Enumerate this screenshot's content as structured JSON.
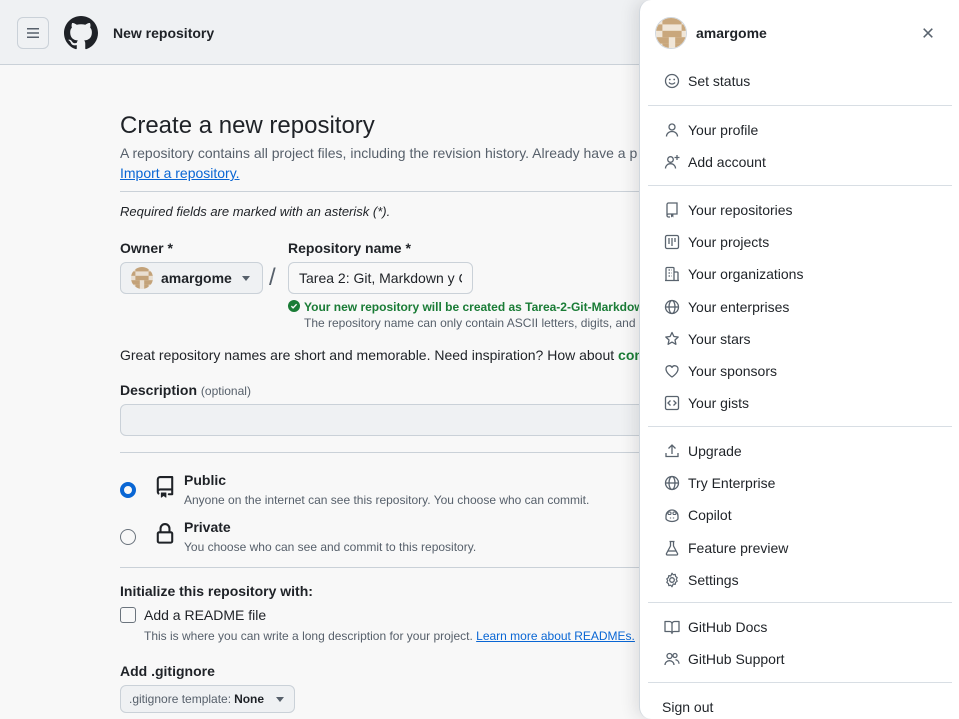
{
  "header": {
    "title": "New repository"
  },
  "form": {
    "title": "Create a new repository",
    "description": "A repository contains all project files, including the revision history. Already have a p",
    "import_link": "Import a repository.",
    "required_note": "Required fields are marked with an asterisk (*).",
    "owner_label": "Owner *",
    "owner_value": "amargome",
    "slash": "/",
    "repo_label": "Repository name *",
    "repo_value": "Tarea 2: Git, Markdown y C",
    "valid_message": "Your new repository will be created as Tarea-2-Git-Markdown-",
    "ascii_note": "The repository name can only contain ASCII letters, digits, and t",
    "inspiration_text": "Great repository names are short and memorable. Need inspiration? How about ",
    "inspiration_word": "con",
    "description_label": "Description",
    "description_optional": "(optional)",
    "description_value": "",
    "visibility": [
      {
        "title": "Public",
        "desc": "Anyone on the internet can see this repository. You choose who can commit.",
        "checked": true
      },
      {
        "title": "Private",
        "desc": "You choose who can see and commit to this repository.",
        "checked": false
      }
    ],
    "init_label": "Initialize this repository with:",
    "readme_label": "Add a README file",
    "readme_desc": "This is where you can write a long description for your project. ",
    "readme_link": "Learn more about READMEs.",
    "gitignore_label": "Add .gitignore",
    "gitignore_prefix": ".gitignore template:",
    "gitignore_value": "None"
  },
  "user_menu": {
    "username": "amargome",
    "groups": [
      [
        {
          "label": "Set status",
          "icon": "smiley-icon"
        }
      ],
      [
        {
          "label": "Your profile",
          "icon": "person-icon"
        },
        {
          "label": "Add account",
          "icon": "person-add-icon"
        }
      ],
      [
        {
          "label": "Your repositories",
          "icon": "repo-icon"
        },
        {
          "label": "Your projects",
          "icon": "project-icon"
        },
        {
          "label": "Your organizations",
          "icon": "organization-icon"
        },
        {
          "label": "Your enterprises",
          "icon": "globe-icon"
        },
        {
          "label": "Your stars",
          "icon": "star-icon"
        },
        {
          "label": "Your sponsors",
          "icon": "heart-icon"
        },
        {
          "label": "Your gists",
          "icon": "code-square-icon"
        }
      ],
      [
        {
          "label": "Upgrade",
          "icon": "upload-icon"
        },
        {
          "label": "Try Enterprise",
          "icon": "globe-icon"
        },
        {
          "label": "Copilot",
          "icon": "copilot-icon"
        },
        {
          "label": "Feature preview",
          "icon": "beaker-icon"
        },
        {
          "label": "Settings",
          "icon": "gear-icon"
        }
      ],
      [
        {
          "label": "GitHub Docs",
          "icon": "book-icon"
        },
        {
          "label": "GitHub Support",
          "icon": "people-icon"
        }
      ],
      [
        {
          "label": "Sign out",
          "icon": ""
        }
      ]
    ]
  },
  "colors": {
    "accent": "#0969da",
    "success": "#1a7f37",
    "muted": "#59636e",
    "border": "#d0d7de"
  }
}
